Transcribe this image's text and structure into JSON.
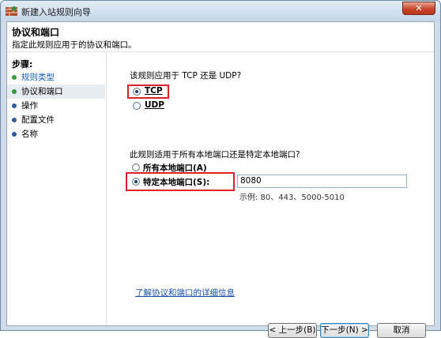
{
  "window": {
    "title": "新建入站规则向导",
    "close_label": "✕"
  },
  "header": {
    "title": "协议和端口",
    "subtitle": "指定此规则应用于的协议和端口。"
  },
  "steps": {
    "label": "步骤:",
    "items": [
      {
        "label": "规则类型",
        "state": "done"
      },
      {
        "label": "协议和端口",
        "state": "current"
      },
      {
        "label": "操作",
        "state": "pending"
      },
      {
        "label": "配置文件",
        "state": "pending"
      },
      {
        "label": "名称",
        "state": "pending"
      }
    ]
  },
  "protocol": {
    "question": "该规则应用于 TCP 还是 UDP?",
    "options": [
      {
        "label": "TCP",
        "checked": true
      },
      {
        "label": "UDP",
        "checked": false
      }
    ]
  },
  "ports": {
    "question": "此规则适用于所有本地端口还是特定本地端口?",
    "all_label": "所有本地端口(A)",
    "specific_label": "特定本地端口(S):",
    "value": "8080",
    "example": "示例: 80、443、5000-5010"
  },
  "link": "了解协议和端口的详细信息",
  "buttons": {
    "back": "< 上一步(B)",
    "next": "下一步(N) >",
    "cancel": "取消"
  },
  "colors": {
    "highlight_border": "#e0202b",
    "link": "#1a4fa8"
  }
}
